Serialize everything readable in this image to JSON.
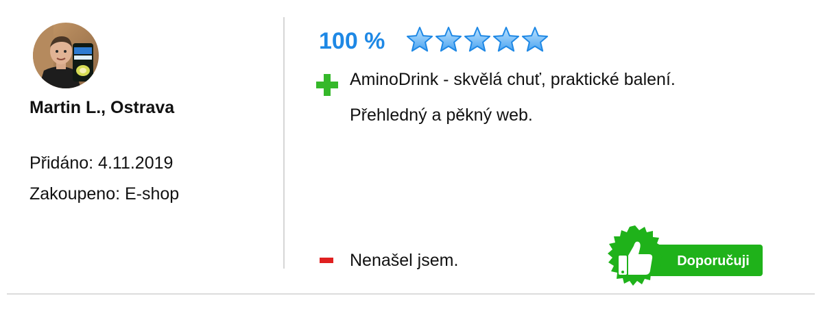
{
  "reviewer": {
    "name": "Martin L., Ostrava",
    "added": "Přidáno: 4.11.2019",
    "purchased": "Zakoupeno: E-shop"
  },
  "rating": {
    "percent_label": "100 %",
    "stars_filled": 5,
    "stars_total": 5,
    "star_color": "#1e88e5"
  },
  "pros": {
    "icon": "plus-icon",
    "lines": [
      "AminoDrink - skvělá chuť, praktické balení.",
      "Přehledný a pěkný web."
    ]
  },
  "cons": {
    "icon": "minus-icon",
    "lines": [
      "Nenašel jsem."
    ]
  },
  "recommend_badge": {
    "label": "Doporučuji",
    "icon": "thumbs-up-icon",
    "color": "#1fb21a"
  }
}
